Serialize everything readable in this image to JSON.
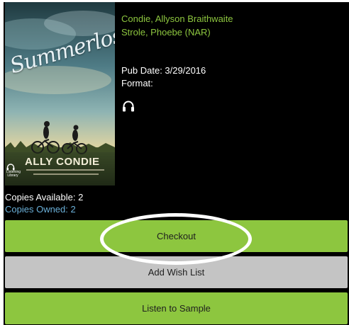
{
  "book": {
    "cover": {
      "title": "Summerlost",
      "author": "ALLY CONDIE",
      "audio_badge_label": "Listening Library"
    },
    "authors": [
      "Condie, Allyson Braithwaite",
      "Strole, Phoebe (NAR)"
    ],
    "pub_date": "Pub Date: 3/29/2016",
    "format_label": "Format:",
    "format_icon": "headphones-icon"
  },
  "availability": {
    "copies_available": "Copies Available: 2",
    "copies_owned": "Copies Owned: 2"
  },
  "actions": {
    "checkout_label": "Checkout",
    "wishlist_label": "Add Wish List",
    "sample_label": "Listen to Sample"
  },
  "colors": {
    "background": "#000000",
    "accent_green": "#8dc63f",
    "link_blue": "#6bb0d8",
    "button_gray": "#c4c4c4",
    "highlight_annotation": "#ffffff"
  }
}
